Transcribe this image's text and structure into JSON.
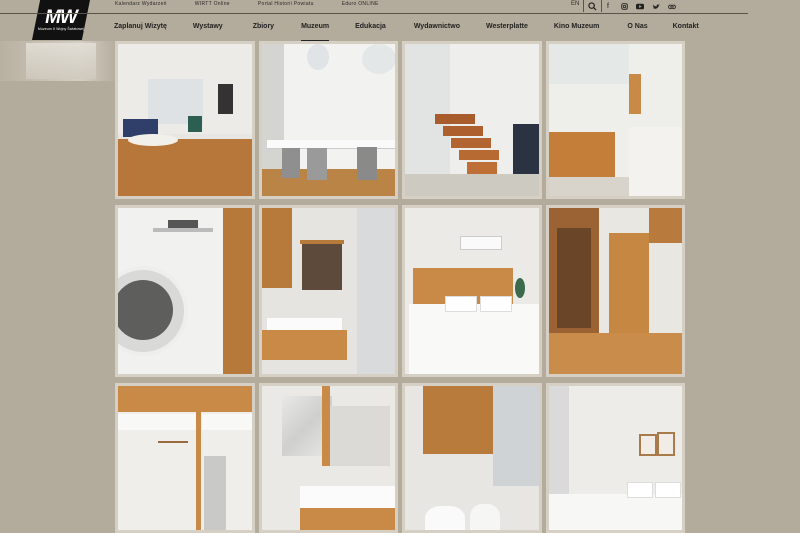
{
  "logo": {
    "mark": "MW",
    "sub": "Muzeum II Wojny Światowej"
  },
  "utility": [
    "Kalendarz Wydarzeń",
    "WIRTT Online",
    "Portal Historii Powiatu",
    "Eduro ONLINE"
  ],
  "lang": "EN",
  "icons": {
    "search": "search-icon",
    "social": [
      "facebook-icon",
      "instagram-icon",
      "youtube-icon",
      "twitter-icon",
      "tripadvisor-icon"
    ]
  },
  "nav": {
    "items": [
      "Zaplanuj Wizytę",
      "Wystawy",
      "Zbiory",
      "Muzeum",
      "Edukacja",
      "Wydawnictwo",
      "Westerplatte",
      "Kino Muzeum",
      "O Nas",
      "Kontakt"
    ],
    "active": "Muzeum"
  },
  "gallery": {
    "photos": [
      "living-room",
      "dining-table",
      "staircase",
      "kitchen",
      "washing-machine",
      "bathroom-sink",
      "bedroom",
      "hallway-wardrobe",
      "closet",
      "marble-bathroom",
      "toilet-shower",
      "bedroom-paintings"
    ]
  },
  "colors": {
    "background": "#b3ab9b",
    "logo": "#111111",
    "frame": "#d6d0c4",
    "wood": "#c98a47"
  }
}
